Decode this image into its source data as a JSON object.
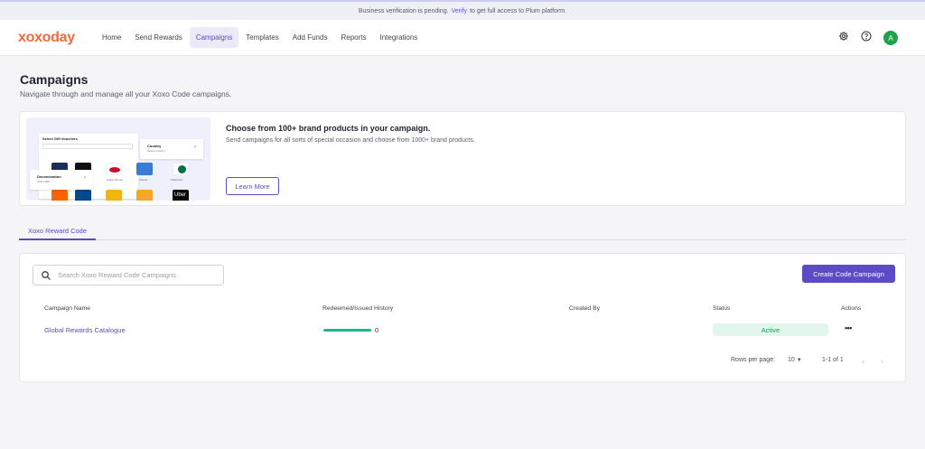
{
  "banner": {
    "prefix": "Business verification is pending.",
    "link": "Verify",
    "suffix": "to get full access to Plum platform."
  },
  "brand": {
    "logo": "xoxoday",
    "color": "#f26a38"
  },
  "nav": {
    "items": [
      {
        "label": "Home"
      },
      {
        "label": "Send Rewards"
      },
      {
        "label": "Campaigns",
        "active": true
      },
      {
        "label": "Templates"
      },
      {
        "label": "Add Funds"
      },
      {
        "label": "Reports"
      },
      {
        "label": "Integrations"
      }
    ],
    "icons": [
      "gear-icon",
      "help-icon"
    ],
    "avatar": "A"
  },
  "page": {
    "title": "Campaigns",
    "subtitle": "Navigate through and manage all your Xoxo Code campaigns."
  },
  "promo": {
    "title": "Choose from 100+ brand products in your campaign.",
    "subtitle": "Send campaigns for all sorts of special occasion and choose from 1000+ brand products.",
    "button": "Learn More",
    "image": {
      "panel_title": "Select Gift Vouchers",
      "country_label": "Country",
      "country_sub": "Select Country",
      "denomination_label": "Denomination",
      "denomination_value": "USD 1000",
      "brands": [
        "Krispy Kreme",
        "Shoots",
        "Starbucks",
        "Home Depot",
        "Lowes",
        "Burger",
        "Uber"
      ]
    }
  },
  "tabs": [
    {
      "label": "Xoxo Reward Code",
      "active": true
    }
  ],
  "table": {
    "search_placeholder": "Search Xoxo Reward Code Campaigns",
    "create_button": "Create Code Campaign",
    "headers": {
      "name": "Campaign Name",
      "redeemed": "Redeemed/Issued History",
      "created_by": "Created By",
      "status": "Status",
      "actions": "Actions"
    },
    "rows": [
      {
        "name": "Global Rewards Catalogue",
        "redeemed": "0",
        "redeemed_progress": 1.0,
        "created_by": "",
        "status": "Active",
        "actions": "•••"
      }
    ],
    "pagination": {
      "rows_per_page_label": "Rows per page:",
      "rows_per_page": "10",
      "range": "1-1 of 1"
    }
  },
  "colors": {
    "accent": "#5b4bc4",
    "status_active_bg": "#e2f6ec",
    "status_active_text": "#1f9b5b",
    "progress": "#1db98a"
  }
}
